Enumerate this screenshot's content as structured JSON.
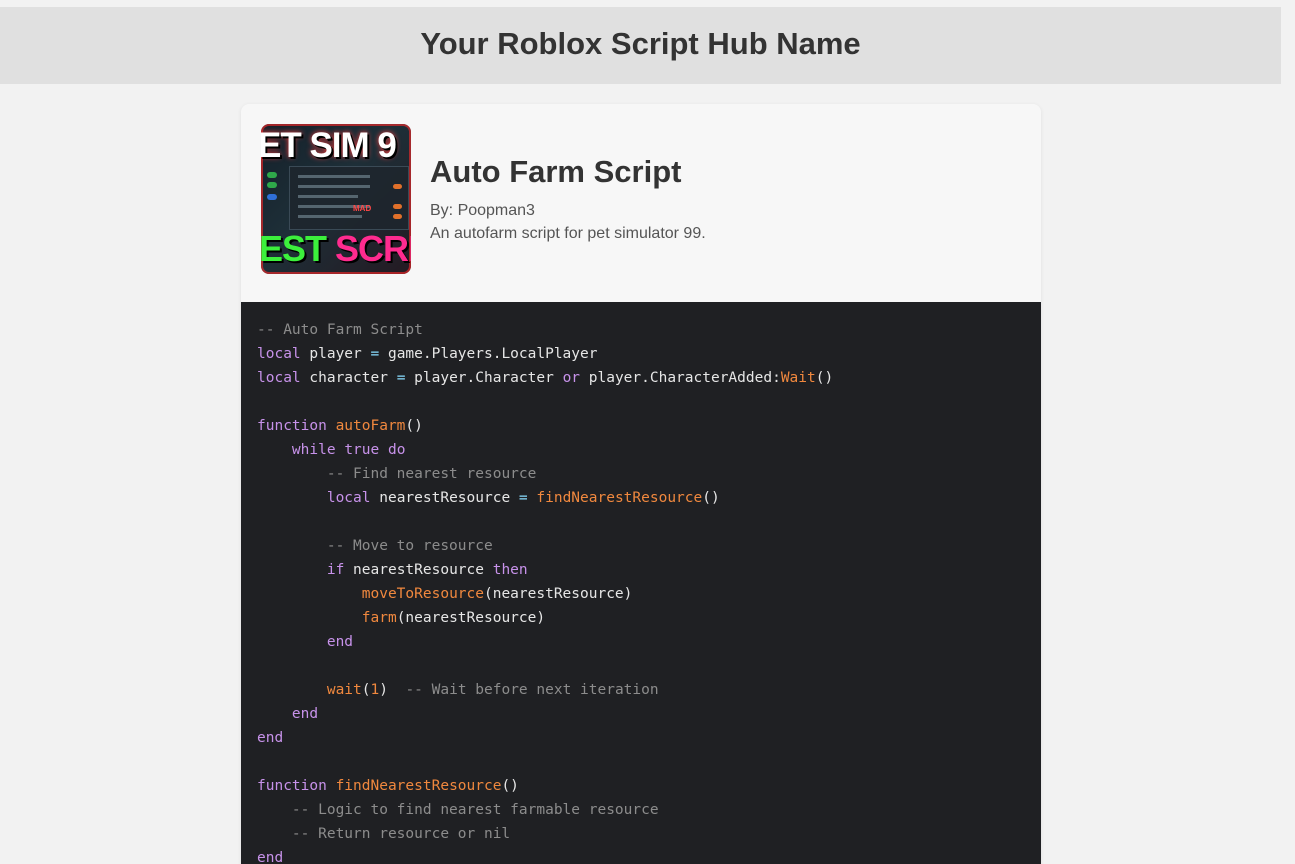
{
  "header": {
    "title": "Your Roblox Script Hub Name"
  },
  "script": {
    "title": "Auto Farm Script",
    "author": "By: Poopman3",
    "description": "An autofarm script for pet simulator 99.",
    "thumbnail": {
      "top_text": "ET SIM 9",
      "bottom_text_green": "EST ",
      "bottom_text_pink": "SCRIP",
      "badge_text": "MAD"
    }
  },
  "colors": {
    "page_background": "#f2f2f2",
    "header_background": "#e0e0e0",
    "card_background": "#f7f7f7",
    "code_background": "#1f2023",
    "comment": "#8c8c8c",
    "keyword": "#c792ea",
    "function": "#f0883e",
    "operator": "#89ddff",
    "identifier": "#e6e6e6"
  },
  "code": {
    "language": "lua",
    "lines": [
      [
        [
          "cm",
          "-- Auto Farm Script"
        ]
      ],
      [
        [
          "kw",
          "local"
        ],
        [
          "id",
          " player "
        ],
        [
          "op",
          "="
        ],
        [
          "id",
          " game.Players.LocalPlayer"
        ]
      ],
      [
        [
          "kw",
          "local"
        ],
        [
          "id",
          " character "
        ],
        [
          "op",
          "="
        ],
        [
          "id",
          " player.Character "
        ],
        [
          "kw",
          "or"
        ],
        [
          "id",
          " player.CharacterAdded:"
        ],
        [
          "fn",
          "Wait"
        ],
        [
          "id",
          "()"
        ]
      ],
      [],
      [
        [
          "kw",
          "function"
        ],
        [
          "id",
          " "
        ],
        [
          "fn",
          "autoFarm"
        ],
        [
          "id",
          "()"
        ]
      ],
      [
        [
          "id",
          "    "
        ],
        [
          "kw",
          "while"
        ],
        [
          "id",
          " "
        ],
        [
          "kw",
          "true"
        ],
        [
          "id",
          " "
        ],
        [
          "kw",
          "do"
        ]
      ],
      [
        [
          "id",
          "        "
        ],
        [
          "cm",
          "-- Find nearest resource"
        ]
      ],
      [
        [
          "id",
          "        "
        ],
        [
          "kw",
          "local"
        ],
        [
          "id",
          " nearestResource "
        ],
        [
          "op",
          "="
        ],
        [
          "id",
          " "
        ],
        [
          "fn",
          "findNearestResource"
        ],
        [
          "id",
          "()"
        ]
      ],
      [],
      [
        [
          "id",
          "        "
        ],
        [
          "cm",
          "-- Move to resource"
        ]
      ],
      [
        [
          "id",
          "        "
        ],
        [
          "kw",
          "if"
        ],
        [
          "id",
          " nearestResource "
        ],
        [
          "kw",
          "then"
        ]
      ],
      [
        [
          "id",
          "            "
        ],
        [
          "fn",
          "moveToResource"
        ],
        [
          "id",
          "(nearestResource)"
        ]
      ],
      [
        [
          "id",
          "            "
        ],
        [
          "fn",
          "farm"
        ],
        [
          "id",
          "(nearestResource)"
        ]
      ],
      [
        [
          "id",
          "        "
        ],
        [
          "kw",
          "end"
        ]
      ],
      [],
      [
        [
          "id",
          "        "
        ],
        [
          "fn",
          "wait"
        ],
        [
          "id",
          "("
        ],
        [
          "num",
          "1"
        ],
        [
          "id",
          ")  "
        ],
        [
          "cm",
          "-- Wait before next iteration"
        ]
      ],
      [
        [
          "id",
          "    "
        ],
        [
          "kw",
          "end"
        ]
      ],
      [
        [
          "kw",
          "end"
        ]
      ],
      [],
      [
        [
          "kw",
          "function"
        ],
        [
          "id",
          " "
        ],
        [
          "fn",
          "findNearestResource"
        ],
        [
          "id",
          "()"
        ]
      ],
      [
        [
          "id",
          "    "
        ],
        [
          "cm",
          "-- Logic to find nearest farmable resource"
        ]
      ],
      [
        [
          "id",
          "    "
        ],
        [
          "cm",
          "-- Return resource or nil"
        ]
      ],
      [
        [
          "kw",
          "end"
        ]
      ]
    ]
  }
}
